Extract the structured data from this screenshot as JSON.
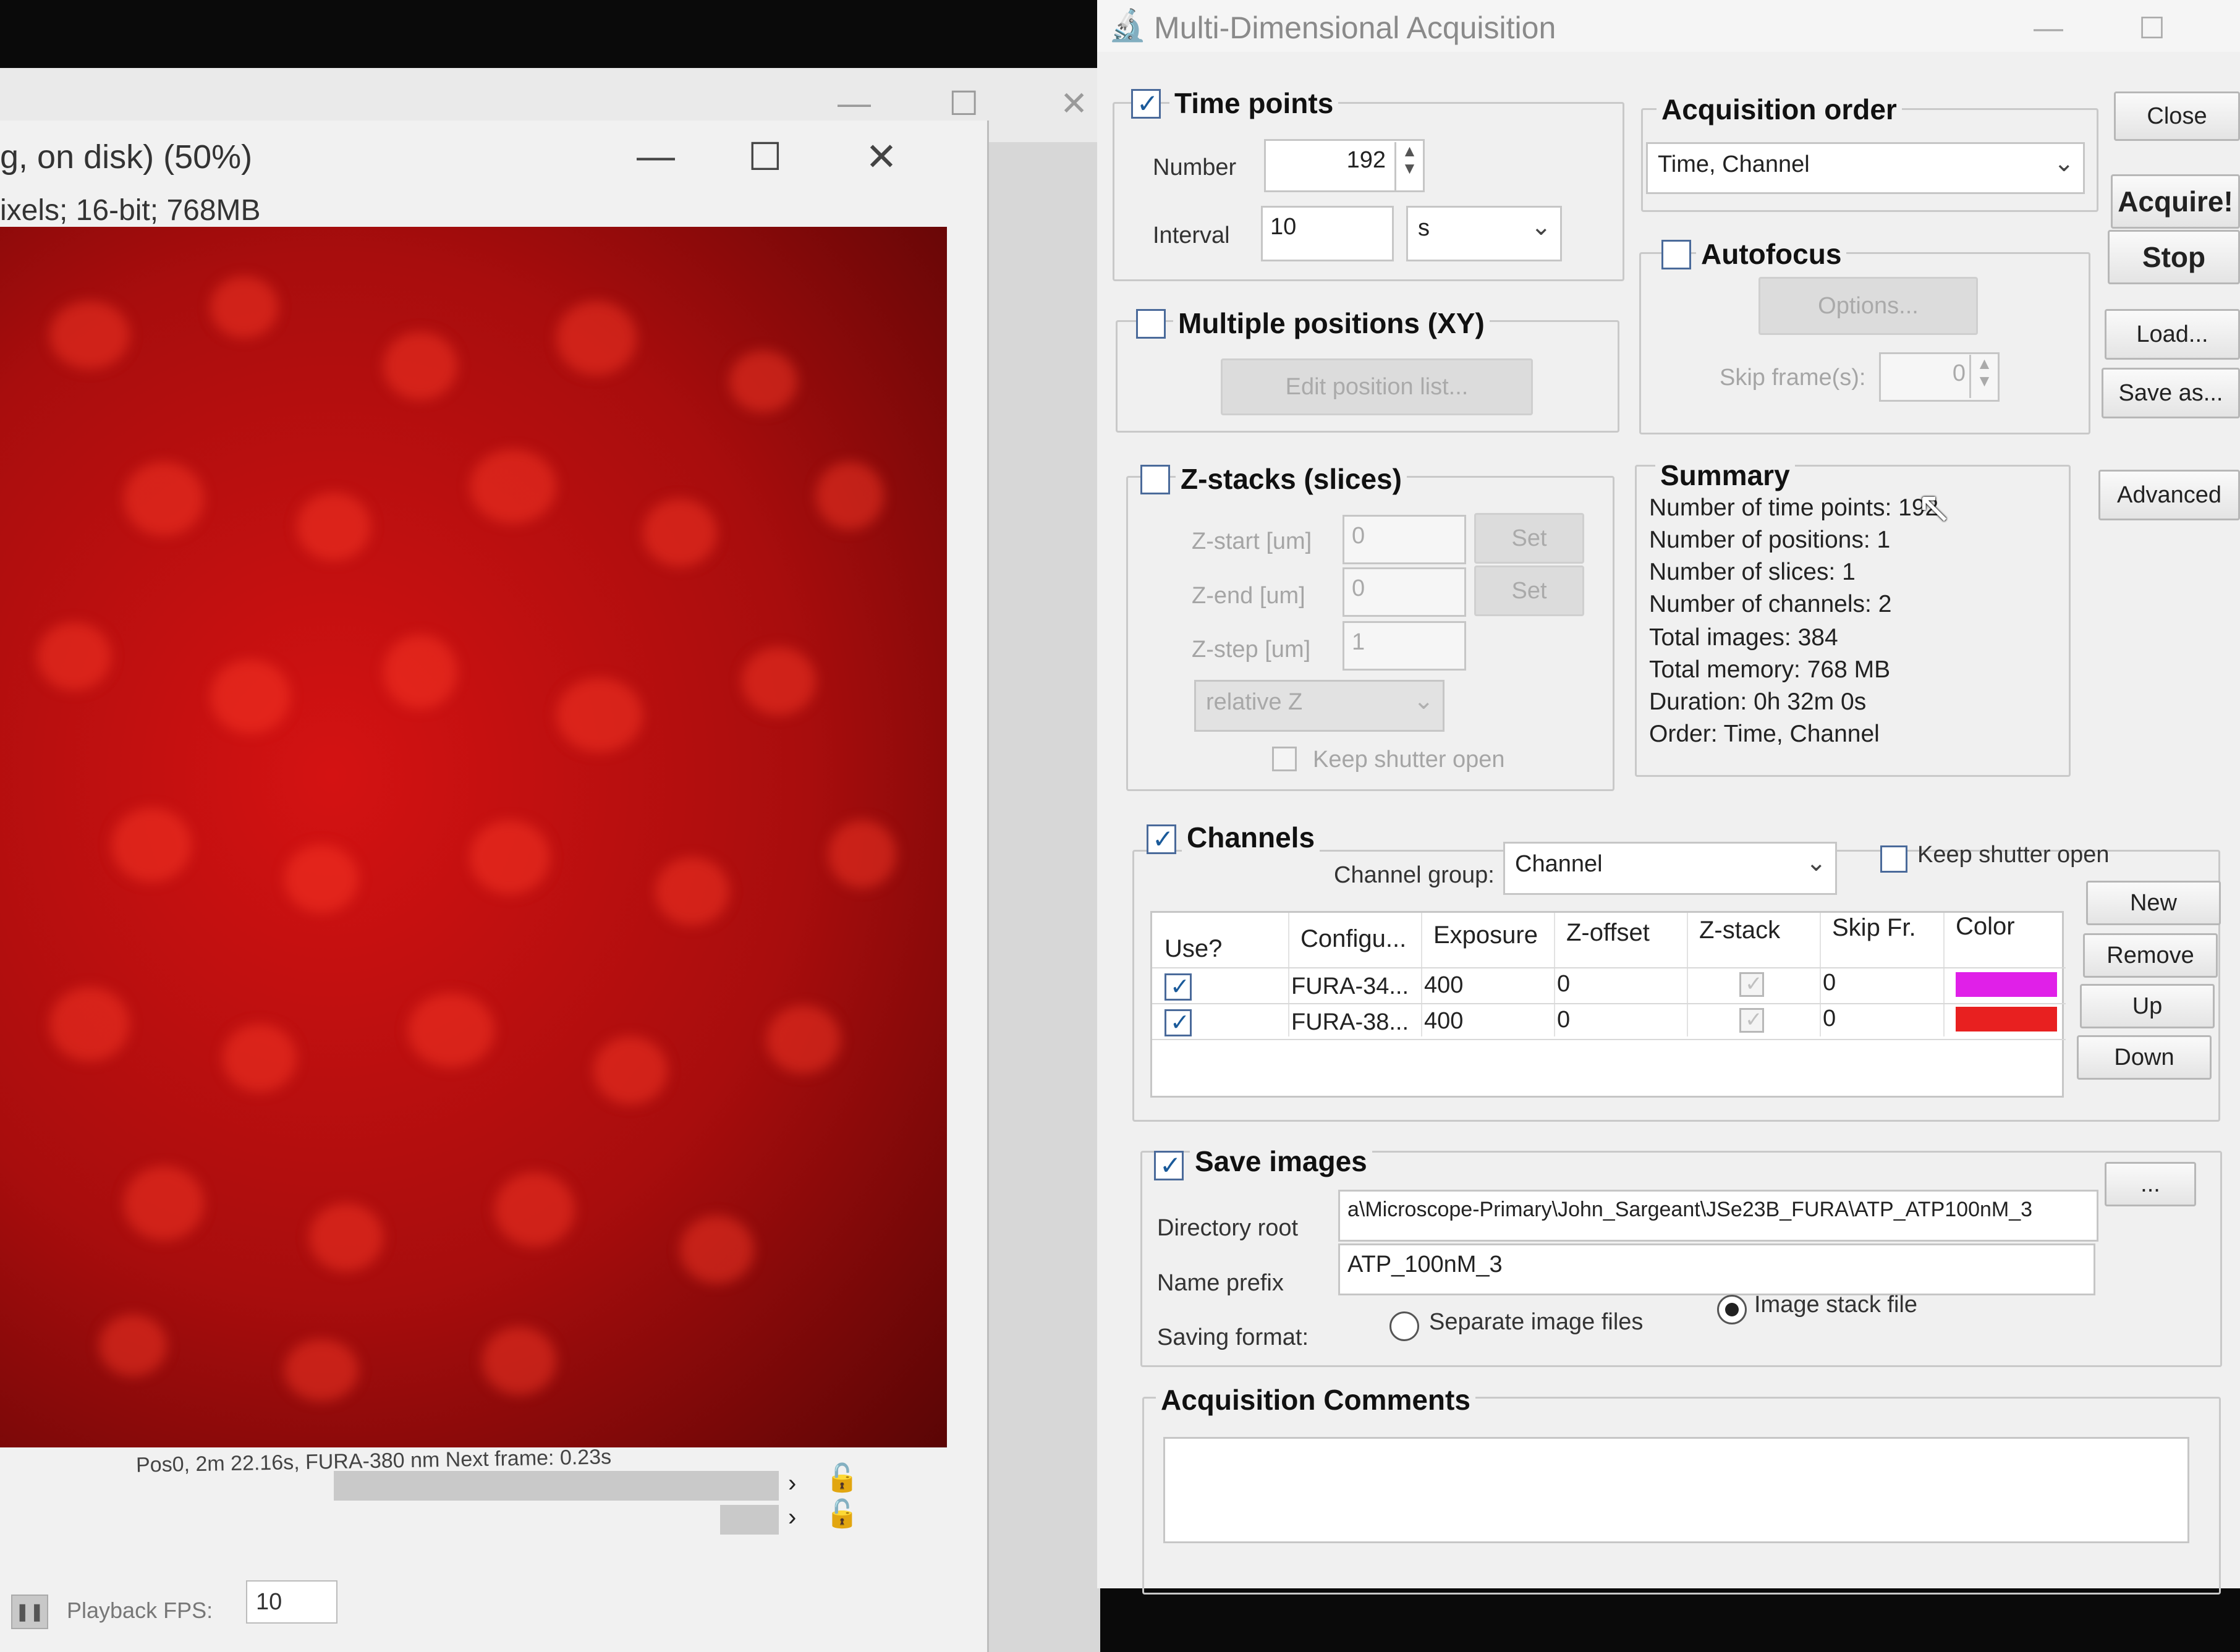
{
  "image_window": {
    "title": "g, on disk) (50%)",
    "subtitle": "ixels; 16-bit; 768MB",
    "status": "Pos0, 2m 22.16s, FURA-380 nm  Next frame: 0.23s",
    "playback_fps_label": "Playback FPS:",
    "playback_fps_value": "10"
  },
  "dialog": {
    "title": "Multi-Dimensional Acquisition",
    "time_points": {
      "title": "Time points",
      "checked": true,
      "number_label": "Number",
      "number_value": "192",
      "interval_label": "Interval",
      "interval_value": "10",
      "interval_unit": "s"
    },
    "multiple_positions": {
      "title": "Multiple positions (XY)",
      "checked": false,
      "edit_button": "Edit position list..."
    },
    "z_stacks": {
      "title": "Z-stacks (slices)",
      "checked": false,
      "z_start_label": "Z-start [um]",
      "z_start_value": "0",
      "z_end_label": "Z-end [um]",
      "z_end_value": "0",
      "z_step_label": "Z-step [um]",
      "z_step_value": "1",
      "set_button": "Set",
      "mode": "relative Z",
      "keep_shutter_open": "Keep shutter open"
    },
    "acquisition_order": {
      "title": "Acquisition order",
      "value": "Time, Channel"
    },
    "autofocus": {
      "title": "Autofocus",
      "checked": false,
      "options_button": "Options...",
      "skip_frames_label": "Skip frame(s):",
      "skip_frames_value": "0"
    },
    "summary": {
      "title": "Summary",
      "lines": [
        "Number of time points: 192",
        "Number of positions: 1",
        "Number of slices: 1",
        "Number of channels: 2",
        "Total images: 384",
        "Total memory: 768 MB",
        "Duration: 0h 32m 0s",
        "Order: Time, Channel"
      ]
    },
    "side_buttons": {
      "close": "Close",
      "acquire": "Acquire!",
      "stop": "Stop",
      "load": "Load...",
      "save_as": "Save as...",
      "advanced": "Advanced"
    },
    "channels": {
      "title": "Channels",
      "checked": true,
      "channel_group_label": "Channel group:",
      "channel_group_value": "Channel",
      "keep_shutter_open": "Keep shutter open",
      "columns": [
        "Use?",
        "Configu...",
        "Exposure",
        "Z-offset",
        "Z-stack",
        "Skip Fr.",
        "Color"
      ],
      "rows": [
        {
          "use": true,
          "config": "FURA-34...",
          "exposure": "400",
          "z_offset": "0",
          "z_stack": true,
          "skip": "0",
          "color": "#e020e8"
        },
        {
          "use": true,
          "config": "FURA-38...",
          "exposure": "400",
          "z_offset": "0",
          "z_stack": true,
          "skip": "0",
          "color": "#e82020"
        }
      ],
      "buttons": {
        "new": "New",
        "remove": "Remove",
        "up": "Up",
        "down": "Down"
      }
    },
    "save_images": {
      "title": "Save images",
      "checked": true,
      "directory_root_label": "Directory root",
      "directory_root_value": "a\\Microscope-Primary\\John_Sargeant\\JSe23B_FURA\\ATP_ATP100nM_3",
      "browse_button": "...",
      "name_prefix_label": "Name prefix",
      "name_prefix_value": "ATP_100nM_3",
      "saving_format_label": "Saving format:",
      "separate_files": "Separate image files",
      "image_stack": "Image stack file",
      "selected_format": "image_stack"
    },
    "comments": {
      "title": "Acquisition Comments",
      "value": ""
    }
  }
}
